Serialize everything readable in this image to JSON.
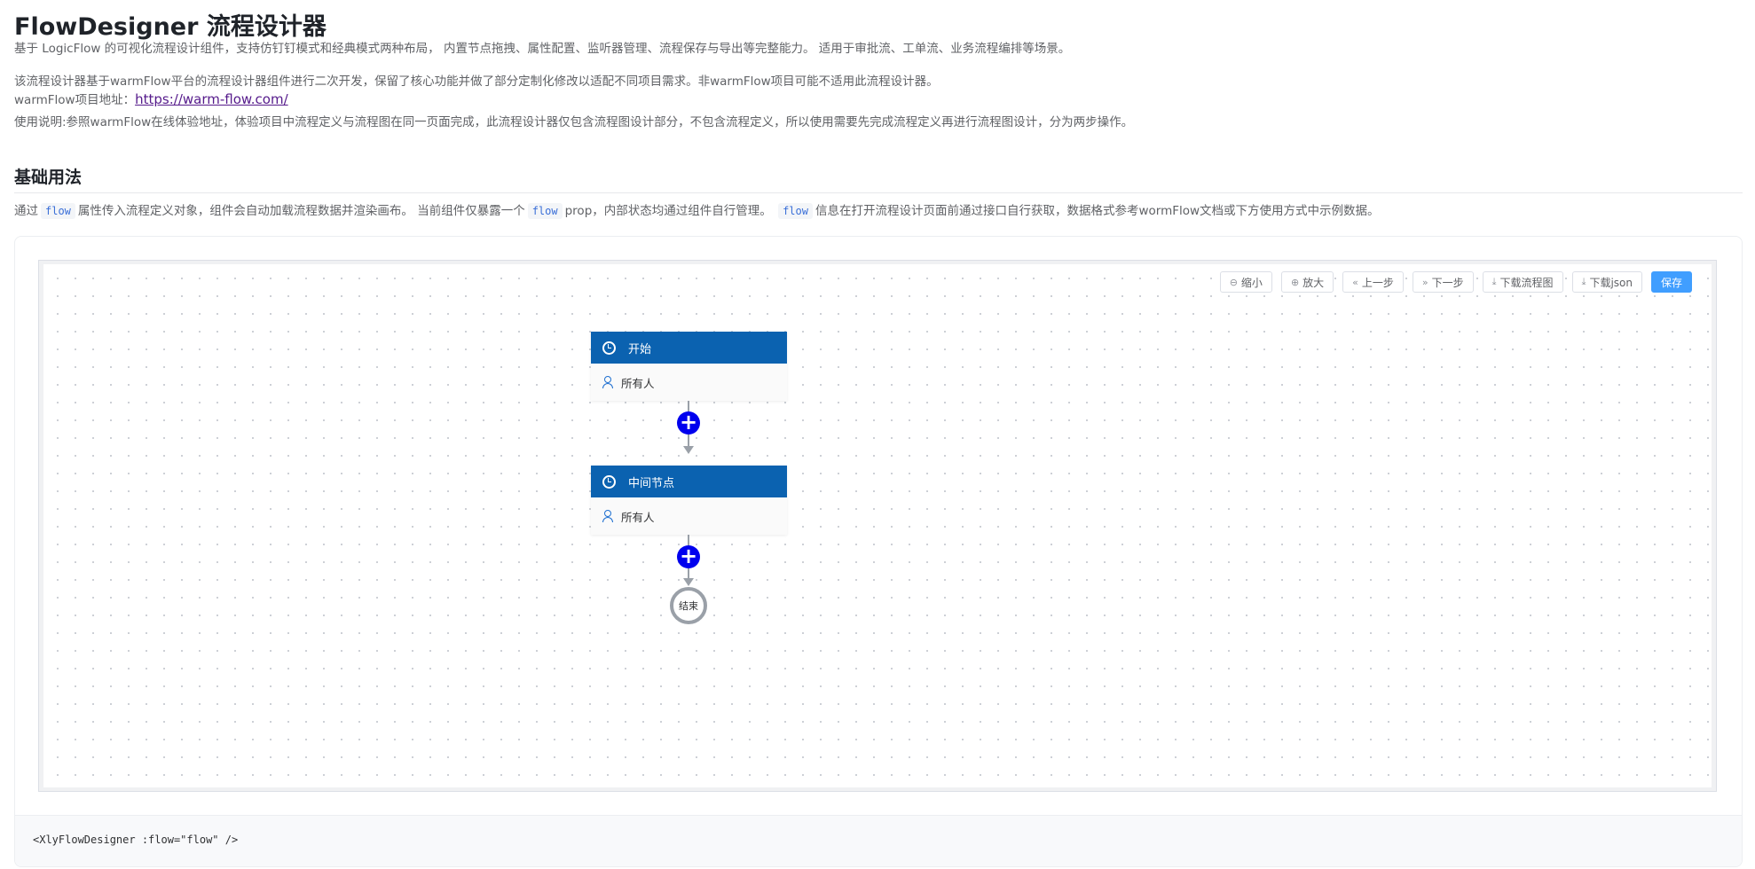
{
  "header": {
    "title": "FlowDesigner 流程设计器",
    "desc_line1": "基于 LogicFlow 的可视化流程设计组件，支持仿钉钉模式和经典模式两种布局， 内置节点拖拽、属性配置、监听器管理、流程保存与导出等完整能力。 适用于审批流、工单流、业务流程编排等场景。",
    "desc_line2": "该流程设计器基于warmFlow平台的流程设计器组件进行二次开发，保留了核心功能并做了部分定制化修改以适配不同项目需求。非warmFlow项目可能不适用此流程设计器。",
    "project_label": "warmFlow项目地址：",
    "project_link": "https://warm-flow.com/",
    "usage_note": "使用说明:参照warmFlow在线体验地址，体验项目中流程定义与流程图在同一页面完成，此流程设计器仅包含流程图设计部分，不包含流程定义，所以使用需要先完成流程定义再进行流程图设计，分为两步操作。"
  },
  "section": {
    "title": "基础用法",
    "usage_prefix": "通过",
    "usage_code1": "flow",
    "usage_mid1": "属性传入流程定义对象，组件会自动加载流程数据并渲染画布。 当前组件仅暴露一个",
    "usage_code2": "flow",
    "usage_mid2": "prop，内部状态均通过组件自行管理。",
    "usage_code3": "flow",
    "usage_suffix": "信息在打开流程设计页面前通过接口自行获取，数据格式参考wormFlow文档或下方使用方式中示例数据。"
  },
  "toolbar": {
    "zoom_out": "缩小",
    "zoom_in": "放大",
    "undo": "上一步",
    "redo": "下一步",
    "download_image": "下载流程图",
    "download_json": "下载json",
    "save": "保存"
  },
  "flow": {
    "start_node": {
      "title": "开始",
      "assignee": "所有人"
    },
    "middle_node": {
      "title": "中间节点",
      "assignee": "所有人"
    },
    "end_node": {
      "label": "结束"
    },
    "add_symbol": "+"
  },
  "code_example": "<XlyFlowDesigner :flow=\"flow\" />",
  "colors": {
    "node_header": "#0b62b0",
    "add_button": "#0000ee",
    "primary_button": "#409eff",
    "edge": "#9aa0a8"
  }
}
